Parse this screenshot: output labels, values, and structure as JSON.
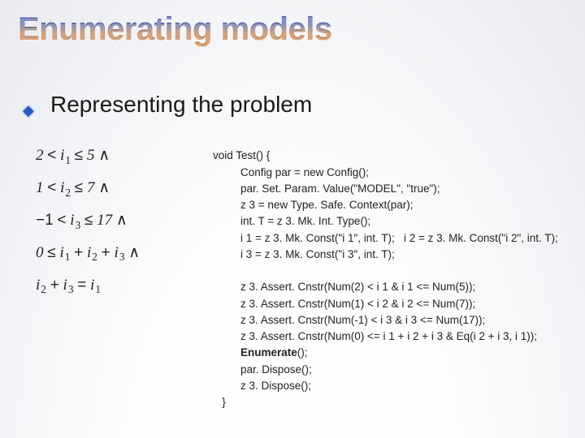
{
  "slide": {
    "title": "Enumerating models",
    "subhead": "Representing the problem"
  },
  "equations": {
    "line1": "2 < i₁ ≤ 5 ∧",
    "line2": "1 < i₂ ≤ 7 ∧",
    "line3": "−1 < i₃ ≤ 17 ∧",
    "line4": "0 ≤ i₁ + i₂ + i₃ ∧",
    "line5": "i₂ + i₃ = i₁"
  },
  "code": {
    "l1": "void Test() {",
    "l2": "Config par = new Config();",
    "l3": "par. Set. Param. Value(\"MODEL\", \"true\");",
    "l4": "z 3 = new Type. Safe. Context(par);",
    "l5": "int. T = z 3. Mk. Int. Type();",
    "l6": "i 1 = z 3. Mk. Const(\"i 1\", int. T);   i 2 = z 3. Mk. Const(\"i 2\", int. T);",
    "l7": "i 3 = z 3. Mk. Const(\"i 3\", int. T);",
    "l8": "",
    "l9": "z 3. Assert. Cnstr(Num(2) < i 1 & i 1 <= Num(5));",
    "l10": "z 3. Assert. Cnstr(Num(1) < i 2 & i 2 <= Num(7));",
    "l11": "z 3. Assert. Cnstr(Num(-1) < i 3 & i 3 <= Num(17));",
    "l12": "z 3. Assert. Cnstr(Num(0) <= i 1 + i 2 + i 3 & Eq(i 2 + i 3, i 1));",
    "l13a": "Enumerate",
    "l13b": "();",
    "l14": "par. Dispose();",
    "l15": "z 3. Dispose();",
    "l16": "}"
  }
}
